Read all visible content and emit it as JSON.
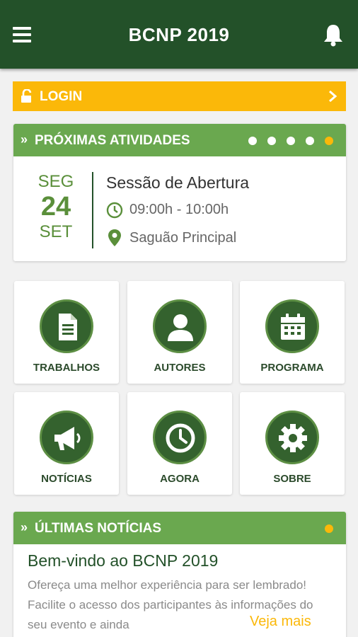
{
  "app": {
    "title": "BCNP 2019"
  },
  "login": {
    "label": "LOGIN"
  },
  "upcoming": {
    "header": "PRÓXIMAS ATIVIDADES",
    "arrow": "»",
    "pager": {
      "total": 5,
      "active_index": 4
    },
    "event": {
      "weekday": "SEG",
      "day": "24",
      "month": "SET",
      "title": "Sessão de Abertura",
      "time": "09:00h - 10:00h",
      "place": "Saguão Principal"
    }
  },
  "menu": [
    {
      "label": "TRABALHOS",
      "icon": "document-icon"
    },
    {
      "label": "AUTORES",
      "icon": "person-icon"
    },
    {
      "label": "PROGRAMA",
      "icon": "calendar-icon"
    },
    {
      "label": "NOTÍCIAS",
      "icon": "megaphone-icon"
    },
    {
      "label": "AGORA",
      "icon": "clock-icon"
    },
    {
      "label": "SOBRE",
      "icon": "gear-icon"
    }
  ],
  "news": {
    "header": "ÚLTIMAS NOTÍCIAS",
    "arrow": "»",
    "title": "Bem-vindo ao BCNP 2019",
    "body": "Ofereça uma melhor experiência para ser lembrado! Facilite o acesso dos participantes às informações do seu evento e ainda",
    "more": "Veja mais"
  },
  "colors": {
    "primary": "#235129",
    "header_green": "#6aa84f",
    "accent": "#fbb809"
  }
}
